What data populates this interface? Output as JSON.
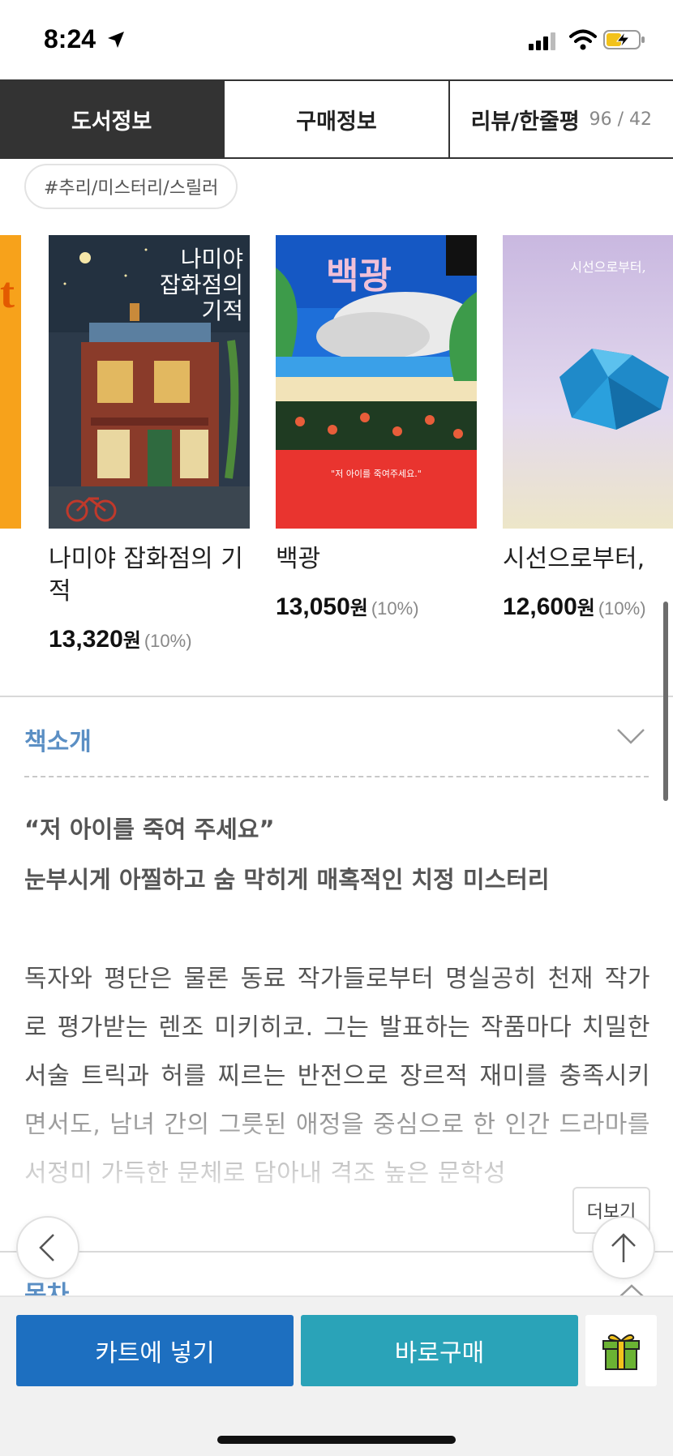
{
  "status_bar": {
    "time": "8:24",
    "icons": [
      "location-arrow-icon",
      "cellular-signal-icon",
      "wifi-icon",
      "battery-charging-icon"
    ]
  },
  "tabs": [
    {
      "label": "도서정보",
      "active": true
    },
    {
      "label": "구매정보",
      "active": false
    },
    {
      "label": "리뷰/한줄평",
      "count": "96 / 42",
      "active": false
    }
  ],
  "hashtag": "#추리/미스터리/스릴러",
  "books": [
    {
      "title": "나미야 잡화점의 기적",
      "cover_text": "나미야\n잡화점의\n기적",
      "price": "13,320",
      "unit": "원",
      "discount": "(10%)"
    },
    {
      "title": "백광",
      "cover_text": "백광",
      "cover_quote": "\"저 아이를 죽여주세요.\"",
      "price": "13,050",
      "unit": "원",
      "discount": "(10%)"
    },
    {
      "title": "시선으로부터,",
      "cover_text": "시선으로부터,",
      "price": "12,600",
      "unit": "원",
      "discount": "(10%)"
    }
  ],
  "intro": {
    "heading": "책소개",
    "quote_line1": "“저 아이를 죽여 주세요”",
    "quote_line2": "눈부시게 아찔하고 숨 막히게 매혹적인 치정 미스터리",
    "body": "독자와 평단은 물론 동료 작가들로부터 명실공히 천재 작가로 평가받는 렌조 미키히코. 그는 발표하는 작품마다 치밀한 서술 트릭과 허를 찌르는 반전으로 장르적 재미를 충족시키면서도, 남녀 간의 그릇된 애정을 중심으로 한 인간 드라마를 서정미 가득한 문체로 담아내 격조 높은 문학성",
    "more_label": "더보기"
  },
  "toc": {
    "heading": "목차"
  },
  "actions": {
    "cart_label": "카트에 넣기",
    "buy_label": "바로구매",
    "gift_icon": "gift-icon"
  },
  "colors": {
    "accent_blue": "#1d6fc0",
    "accent_teal": "#2aa3b8",
    "section_heading": "#5b8fc4",
    "tab_active_bg": "#333333"
  }
}
